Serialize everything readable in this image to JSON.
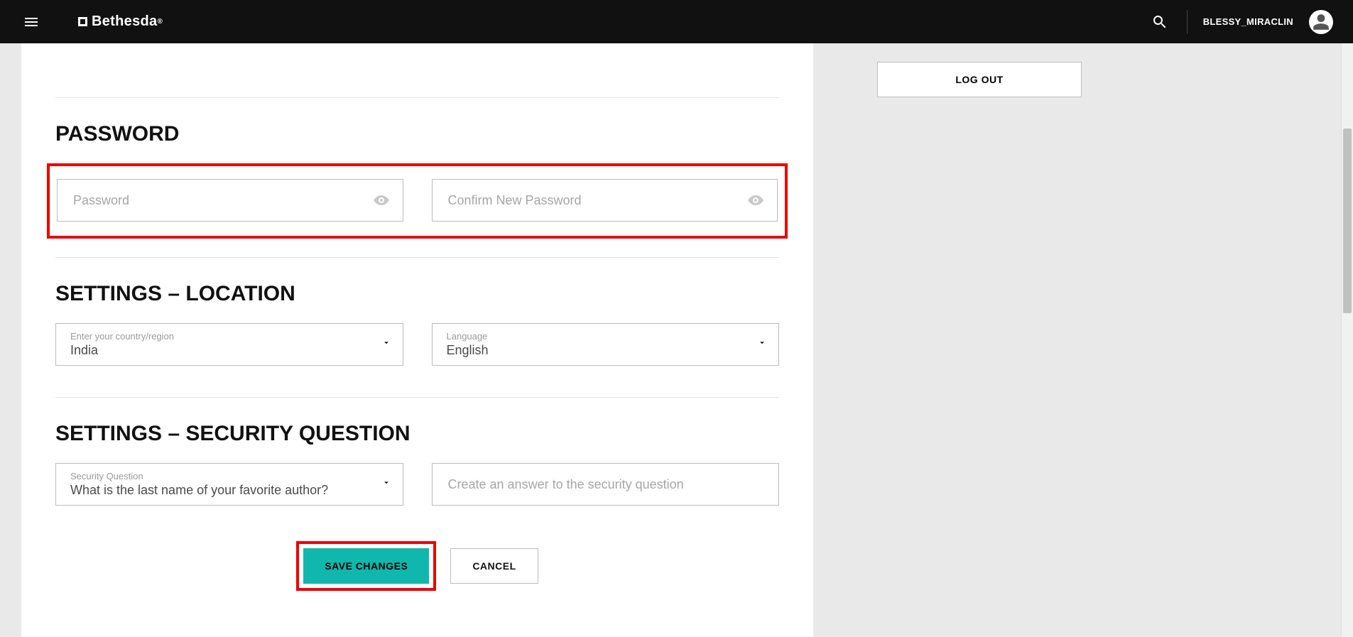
{
  "header": {
    "brand": "Bethesda",
    "username": "BLESSY_MIRACLIN"
  },
  "sidebar": {
    "logout_label": "LOG OUT"
  },
  "sections": {
    "password": {
      "title": "PASSWORD",
      "field1_placeholder": "Password",
      "field2_placeholder": "Confirm New Password"
    },
    "location": {
      "title": "SETTINGS – LOCATION",
      "country_label": "Enter your country/region",
      "country_value": "India",
      "language_label": "Language",
      "language_value": "English"
    },
    "security": {
      "title": "SETTINGS – SECURITY QUESTION",
      "question_label": "Security Question",
      "question_value": "What is the last name of your favorite author?",
      "answer_placeholder": "Create an answer to the security question"
    }
  },
  "actions": {
    "save_label": "SAVE CHANGES",
    "cancel_label": "CANCEL"
  }
}
